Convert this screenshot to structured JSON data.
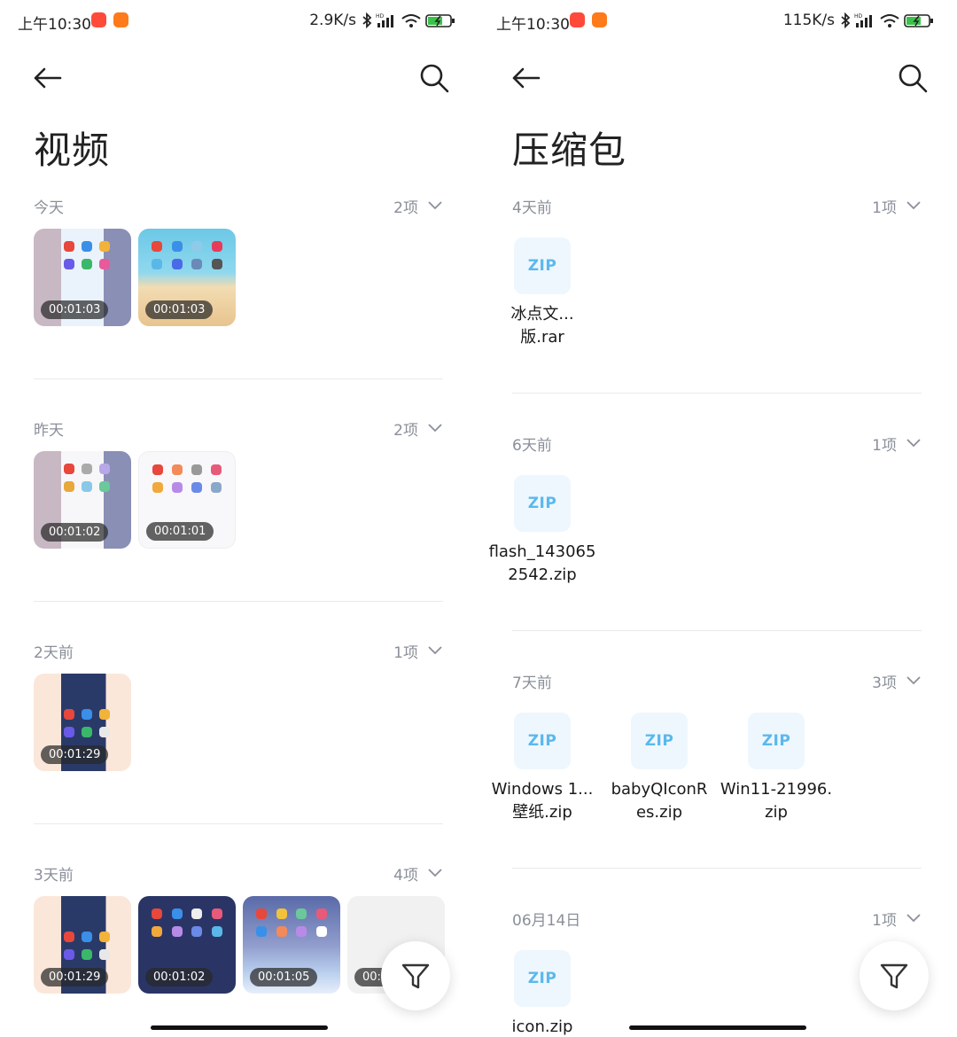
{
  "left": {
    "status": {
      "time": "上午10:30",
      "speed": "2.9K/s"
    },
    "title": "视频",
    "sections": [
      {
        "date": "今天",
        "count": "2项",
        "items": [
          {
            "duration": "00:01:03"
          },
          {
            "duration": "00:01:03"
          }
        ]
      },
      {
        "date": "昨天",
        "count": "2项",
        "items": [
          {
            "duration": "00:01:02"
          },
          {
            "duration": "00:01:01"
          }
        ]
      },
      {
        "date": "2天前",
        "count": "1项",
        "items": [
          {
            "duration": "00:01:29"
          }
        ]
      },
      {
        "date": "3天前",
        "count": "4项",
        "items": [
          {
            "duration": "00:01:29"
          },
          {
            "duration": "00:01:02"
          },
          {
            "duration": "00:01:05"
          },
          {
            "duration": "00:0"
          }
        ]
      }
    ]
  },
  "right": {
    "status": {
      "time": "上午10:30",
      "speed": "115K/s"
    },
    "title": "压缩包",
    "zip_label": "ZIP",
    "sections": [
      {
        "date": "4天前",
        "count": "1项",
        "files": [
          {
            "line1": "冰点文...",
            "line2": "版.rar"
          }
        ]
      },
      {
        "date": "6天前",
        "count": "1项",
        "files": [
          {
            "line1": "flash_143065",
            "line2": "2542.zip"
          }
        ]
      },
      {
        "date": "7天前",
        "count": "3项",
        "files": [
          {
            "line1": "Windows 1...",
            "line2": "壁纸.zip"
          },
          {
            "line1": "babyQIconR",
            "line2": "es.zip"
          },
          {
            "line1": "Win11-21996.",
            "line2": "zip"
          }
        ]
      },
      {
        "date": "06月14日",
        "count": "1项",
        "files": [
          {
            "line1": "icon.zip",
            "line2": ""
          }
        ]
      }
    ]
  },
  "icons": {
    "back": "arrow-left-icon",
    "search": "search-icon",
    "chevron": "chevron-down-icon",
    "filter": "filter-funnel-icon",
    "bluetooth": "bluetooth-icon",
    "signal": "signal-icon",
    "wifi": "wifi-icon",
    "battery": "battery-charging-icon"
  },
  "colors": {
    "accent_zip": "#5bb8ee",
    "section_text": "#8a8f99",
    "zip_bg": "#eef7fd"
  }
}
